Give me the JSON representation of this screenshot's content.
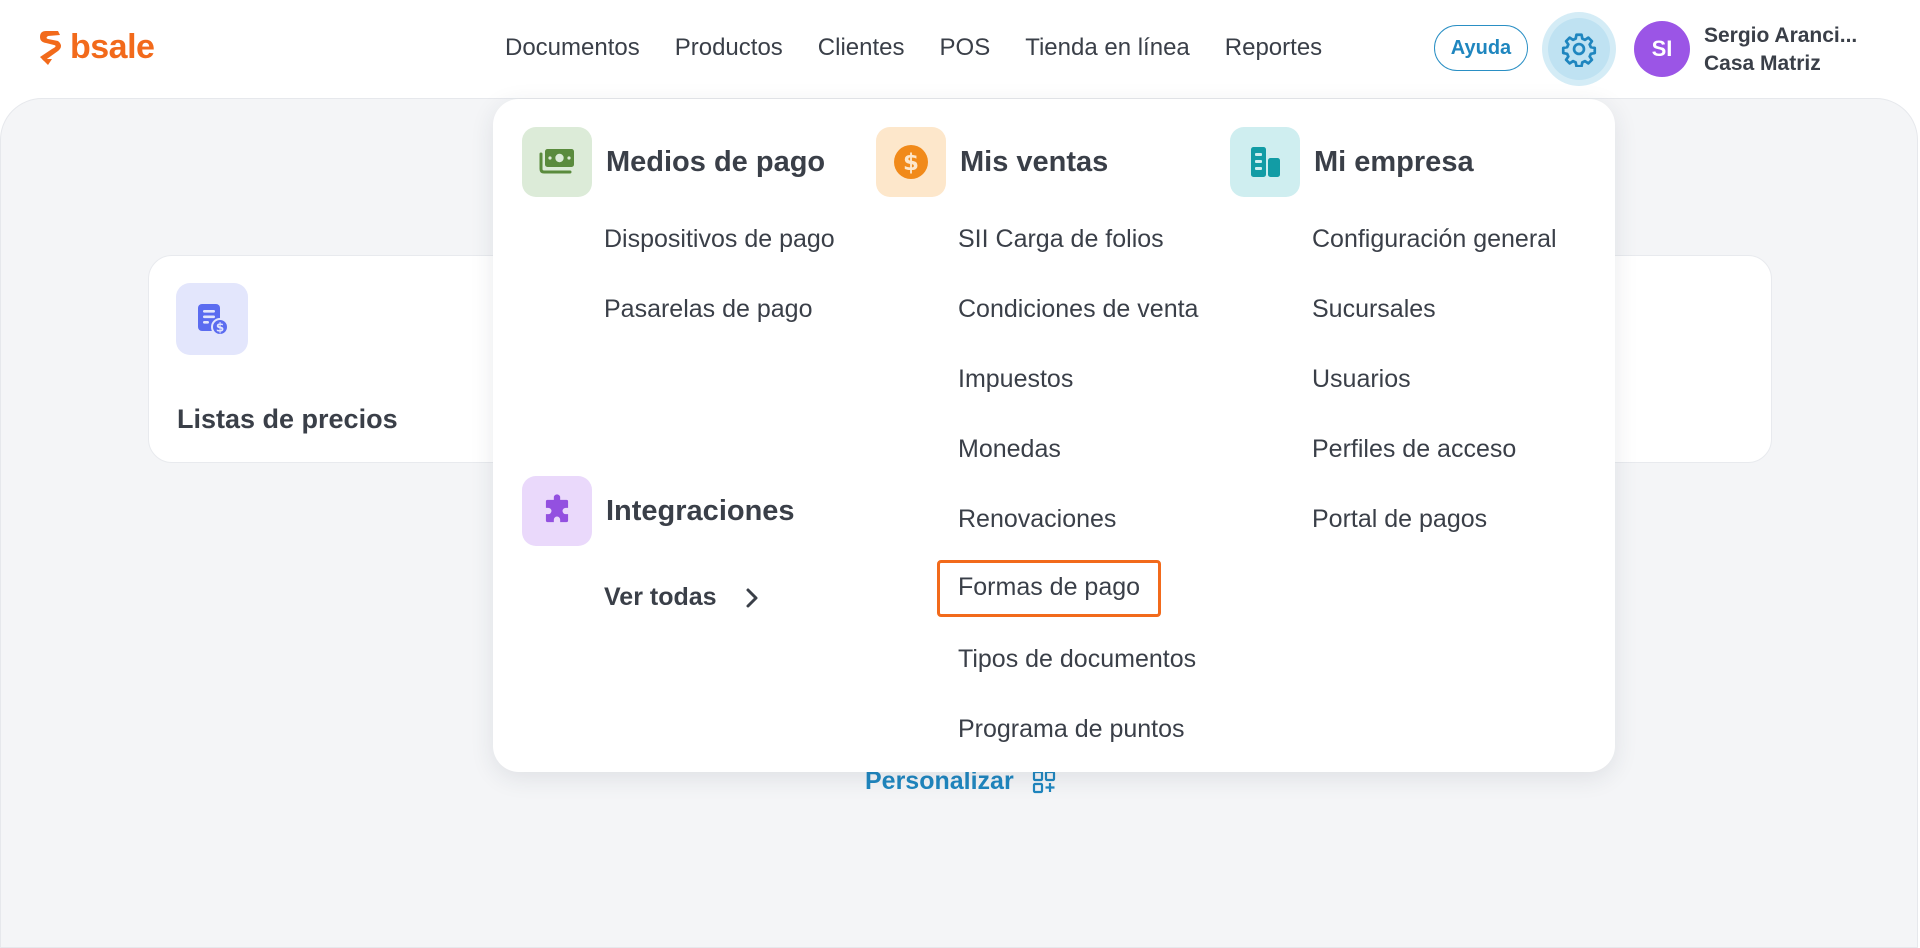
{
  "header": {
    "logo_text": "bsale",
    "nav": [
      "Documentos",
      "Productos",
      "Clientes",
      "POS",
      "Tienda en línea",
      "Reportes"
    ],
    "help_label": "Ayuda",
    "avatar_initials": "SI",
    "user_name": "Sergio Aranci...",
    "user_branch": "Casa Matriz"
  },
  "background": {
    "card_title": "Listas de precios",
    "personalize_label": "Personalizar"
  },
  "menu": {
    "payment": {
      "title": "Medios de pago",
      "items": [
        "Dispositivos de pago",
        "Pasarelas de pago"
      ]
    },
    "integrations": {
      "title": "Integraciones",
      "see_all": "Ver todas"
    },
    "sales": {
      "title": "Mis ventas",
      "items": [
        "SII Carga de folios",
        "Condiciones de venta",
        "Impuestos",
        "Monedas",
        "Renovaciones",
        "Formas de pago",
        "Tipos de documentos",
        "Programa de puntos"
      ],
      "highlighted": "Formas de pago"
    },
    "company": {
      "title": "Mi empresa",
      "items": [
        "Configuración general",
        "Sucursales",
        "Usuarios",
        "Perfiles de acceso",
        "Portal de pagos"
      ]
    }
  },
  "colors": {
    "brand": "#f26a1b",
    "accent": "#1f86bf",
    "highlight_border": "#f26a1b",
    "avatar": "#9b55e6"
  },
  "icons": {
    "payment": "money-icon",
    "integrations": "puzzle-icon",
    "sales": "dollar-coin-icon",
    "company": "buildings-icon",
    "settings": "gear-icon",
    "see_all": "chevron-right-icon",
    "personalize": "qr-add-icon",
    "card": "price-list-icon"
  }
}
